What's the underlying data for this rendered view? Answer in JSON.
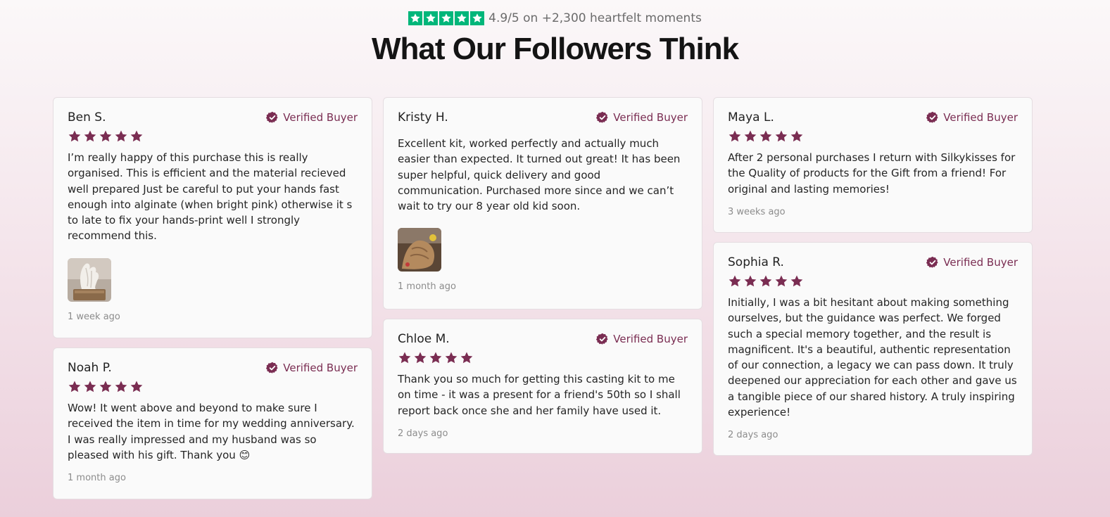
{
  "header": {
    "rating_text": "4.9/5 on +2,300 heartfelt moments",
    "title": "What Our Followers Think",
    "trustpilot_color": "#00b67a",
    "star_count": 5
  },
  "badge_label": "Verified Buyer",
  "accent_color": "#7a2d52",
  "reviews": [
    {
      "name": "Ben S.",
      "stars": 5,
      "text": "I’m really happy of this purchase this is really organised. This is efficient and the material recieved well prepared Just be careful to put your hands fast enough into alginate (when bright pink) otherwise it s to late to fix your hands-print well I strongly recommend this.",
      "has_photo": true,
      "photo_icon": "hand-cast-sculpture",
      "date": "1 week ago"
    },
    {
      "name": "Noah P.",
      "stars": 5,
      "text": "Wow! It went above and beyond to make sure I received the item in time for my wedding anniversary. I was really impressed and my husband was so pleased with his gift. Thank you 😊",
      "has_photo": false,
      "date": "1 month ago"
    },
    {
      "name": "Kristy H.",
      "stars": 0,
      "text": "Excellent kit, worked perfectly and actually much easier than expected. It turned out great! It has been super helpful, quick delivery and good communication. Purchased more since and we can’t wait to try our 8 year old kid soon.",
      "has_photo": true,
      "photo_icon": "hand-cast-photo",
      "date": "1 month ago"
    },
    {
      "name": "Chloe M.",
      "stars": 5,
      "text": "Thank you so much for getting this casting kit to me on time - it was a present for a friend's 50th so I shall report back once she and her family have used it.",
      "has_photo": false,
      "date": "2 days ago"
    },
    {
      "name": "Maya L.",
      "stars": 5,
      "text": "After 2 personal purchases I return with Silkykisses for the Quality of products for the Gift from a friend! For original and lasting memories!",
      "has_photo": false,
      "date": "3 weeks ago"
    },
    {
      "name": "Sophia R.",
      "stars": 5,
      "text": "Initially, I was a bit hesitant about making something ourselves, but the guidance was perfect. We forged such a special memory together, and the result is magnificent. It's a beautiful, authentic representation of our connection, a legacy we can pass down. It truly deepened our appreciation for each other and gave us a tangible piece of our shared history. A truly inspiring experience!",
      "has_photo": false,
      "date": "2 days ago"
    }
  ]
}
